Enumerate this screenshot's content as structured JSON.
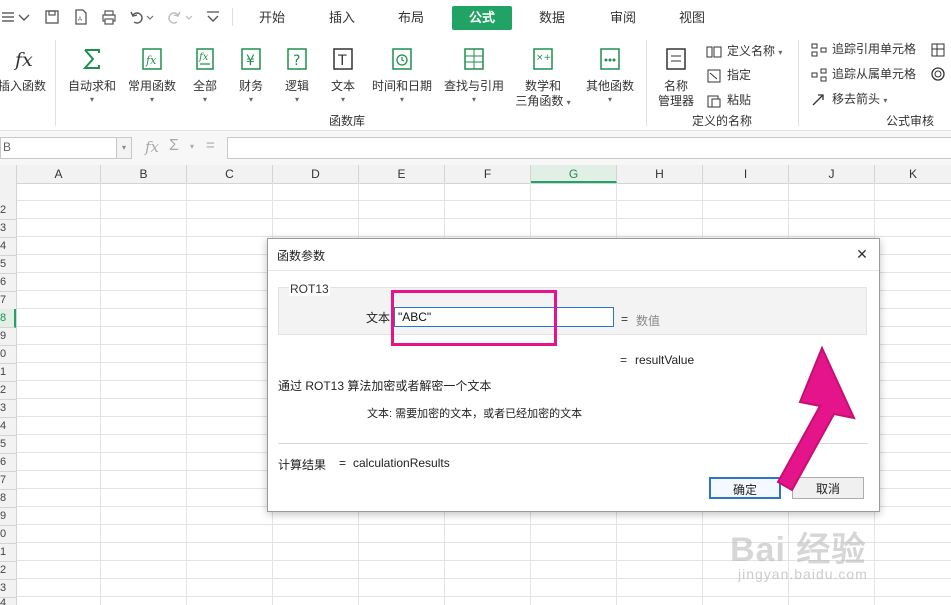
{
  "tabs": [
    "开始",
    "插入",
    "布局",
    "公式",
    "数据",
    "审阅",
    "视图"
  ],
  "active_tab": "公式",
  "ribbon": {
    "insert_function": "插入函数",
    "buttons": [
      {
        "label": "自动求和",
        "icon": "sigma-icon"
      },
      {
        "label": "常用函数",
        "icon": "fx-star-icon"
      },
      {
        "label": "全部",
        "icon": "fx-all-icon"
      },
      {
        "label": "财务",
        "icon": "yen-icon"
      },
      {
        "label": "逻辑",
        "icon": "question-icon"
      },
      {
        "label": "文本",
        "icon": "text-t-icon"
      },
      {
        "label": "时间和日期",
        "icon": "clock-icon"
      },
      {
        "label": "查找与引用",
        "icon": "lookup-icon"
      },
      {
        "label": "数学和",
        "label2": "三角函数",
        "icon": "math-icon"
      },
      {
        "label": "其他函数",
        "icon": "more-functions-icon"
      }
    ],
    "group_function_library": "函数库",
    "name_manager_line1": "名称",
    "name_manager_line2": "管理器",
    "define_name": "定义名称",
    "specify": "指定",
    "paste": "粘贴",
    "group_defined_names": "定义的名称",
    "trace_precedents": "追踪引用单元格",
    "trace_dependents": "追踪从属单元格",
    "remove_arrows": "移去箭头",
    "group_formula_auditing": "公式审核"
  },
  "formula_bar": {
    "name_box": "B",
    "fx": "fx",
    "sigma": "Σ",
    "equals": "="
  },
  "columns": [
    "A",
    "B",
    "C",
    "D",
    "E",
    "F",
    "G",
    "H",
    "I",
    "J",
    "K"
  ],
  "selected_column": "G",
  "rows": [
    "2",
    "3",
    "4",
    "5",
    "6",
    "7",
    "8",
    "9",
    "0",
    "1",
    "2",
    "3",
    "4",
    "5",
    "6",
    "7",
    "8",
    "9",
    "0",
    "1",
    "2",
    "3",
    "4"
  ],
  "dialog": {
    "title": "函数参数",
    "close": "✕",
    "function_name": "ROT13",
    "arg_label": "文本",
    "arg_value": "\"ABC\"",
    "arg_eq": "=",
    "arg_type": "数值",
    "result_eq": "=",
    "result_value": "resultValue",
    "description": "通过 ROT13 算法加密或者解密一个文本",
    "arg_description": "文本: 需要加密的文本，或者已经加密的文本",
    "calc_label": "计算结果",
    "calc_eq": "=",
    "calc_value": "calculationResults",
    "ok": "确定",
    "cancel": "取消"
  },
  "watermark": {
    "logo": "Bai 经验",
    "url": "jingyan.baidu.com"
  },
  "colors": {
    "accent_green": "#21a366",
    "highlight_pink": "#e6148a",
    "focus_blue": "#2a74c9"
  }
}
